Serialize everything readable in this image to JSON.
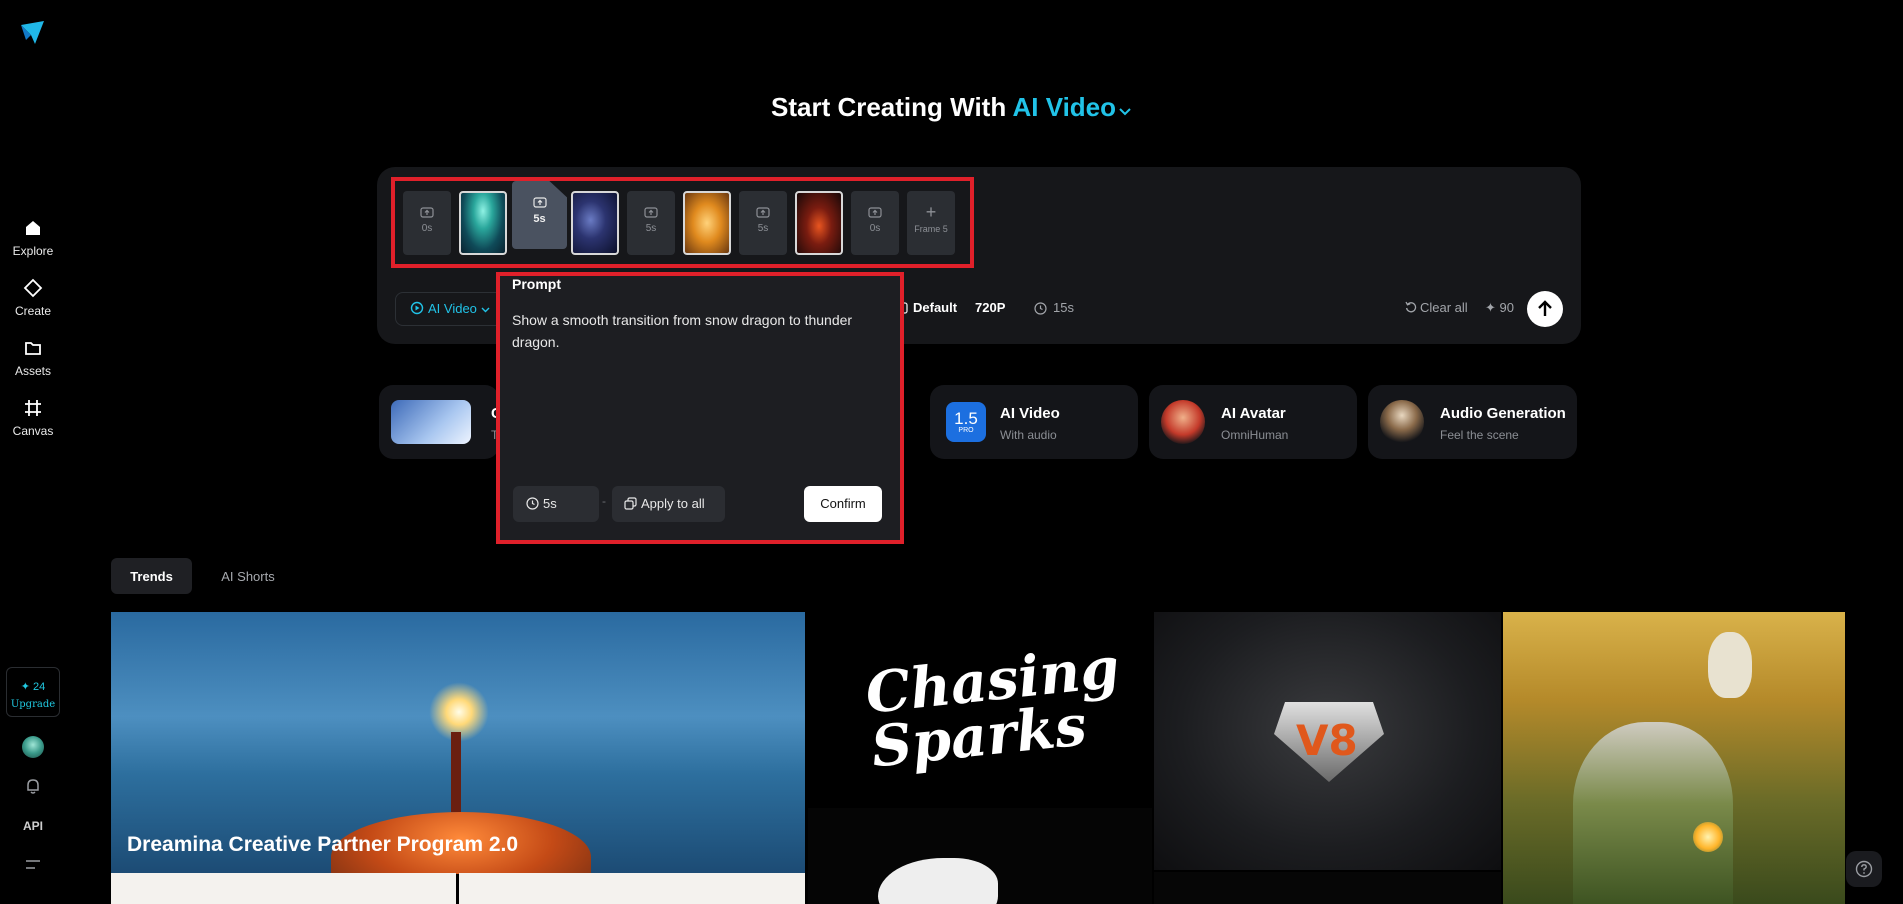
{
  "sidebar": {
    "nav": [
      {
        "label": "Explore",
        "icon": "home-icon"
      },
      {
        "label": "Create",
        "icon": "diamond-icon"
      },
      {
        "label": "Assets",
        "icon": "folder-icon"
      },
      {
        "label": "Canvas",
        "icon": "hash-frame-icon"
      }
    ],
    "credits": "✦ 24",
    "upgrade": "Upgrade",
    "api": "API"
  },
  "heading": {
    "prefix": "Start Creating With",
    "mode": "AI Video"
  },
  "composer": {
    "frames": [
      {
        "type": "empty",
        "duration": "0s"
      },
      {
        "type": "image",
        "image": "snow dragon"
      },
      {
        "type": "active",
        "duration": "5s"
      },
      {
        "type": "image",
        "image": "thunder dragon"
      },
      {
        "type": "empty",
        "duration": "5s"
      },
      {
        "type": "image",
        "image": "golden dragon"
      },
      {
        "type": "empty",
        "duration": "5s"
      },
      {
        "type": "image",
        "image": "fire dragon"
      },
      {
        "type": "empty",
        "duration": "0s"
      },
      {
        "type": "add",
        "label": "Frame 5"
      }
    ],
    "mode_button": "AI Video",
    "aspect": "Default",
    "resolution": "720P",
    "total_duration": "15s",
    "clear_all": "Clear all",
    "credit_cost": "✦ 90"
  },
  "prompt_popover": {
    "title": "Prompt",
    "text": "Show a smooth transition from snow dragon to thunder dragon.",
    "duration": "5s",
    "separator": "-",
    "apply_all": "Apply to all",
    "confirm": "Confirm"
  },
  "features": [
    {
      "title": "C",
      "subtitle": "T"
    },
    {
      "title": "AI Video",
      "subtitle": "With audio",
      "badge": "1.5",
      "badge_sub": "PRO"
    },
    {
      "title": "AI Avatar",
      "subtitle": "OmniHuman"
    },
    {
      "title": "Audio Generation",
      "subtitle": "Feel the scene"
    }
  ],
  "tabs": [
    {
      "label": "Trends",
      "active": true
    },
    {
      "label": "AI Shorts",
      "active": false
    }
  ],
  "gallery": {
    "partner_caption": "Dreamina Creative Partner Program 2.0",
    "chasing_text": "Chasing Sparks",
    "v8_text": "V8"
  },
  "colors": {
    "accent": "#21c3e8",
    "highlight": "#e0202a",
    "background": "#000000"
  }
}
